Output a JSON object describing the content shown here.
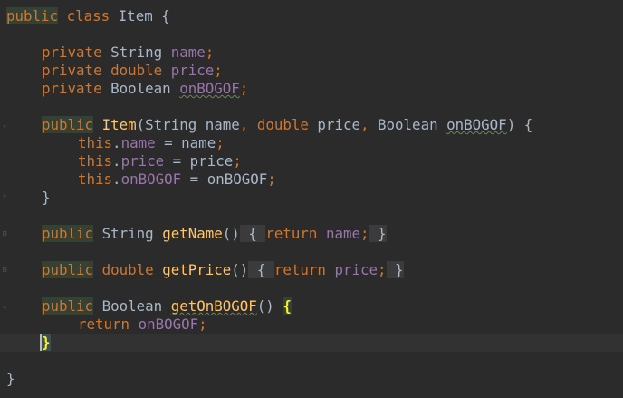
{
  "editor": {
    "class_decl": {
      "kw1": "public",
      "kw2": "class",
      "name": "Item",
      "brace": "{"
    },
    "fields": [
      {
        "mod": "private",
        "type": "String",
        "name": "name",
        "semi": ";"
      },
      {
        "mod": "private",
        "type": "double",
        "name": "price",
        "semi": ";"
      },
      {
        "mod": "private",
        "type": "Boolean",
        "name": "onBOGOF",
        "semi": ";"
      }
    ],
    "ctor": {
      "mod": "public",
      "name": "Item",
      "paren_open": "(",
      "type1": "String",
      "p1": "name",
      "comma1": ",",
      "type2": "double",
      "p2": "price",
      "comma2": ",",
      "type3": "Boolean",
      "p3": "onBOGOF",
      "paren_close": ")",
      "brace": "{",
      "body": [
        {
          "this": "this",
          "dot": ".",
          "field": "name",
          "eq": "=",
          "val": "name",
          "semi": ";"
        },
        {
          "this": "this",
          "dot": ".",
          "field": "price",
          "eq": "=",
          "val": "price",
          "semi": ";"
        },
        {
          "this": "this",
          "dot": ".",
          "field": "onBOGOF",
          "eq": "=",
          "val": "onBOGOF",
          "semi": ";"
        }
      ],
      "close": "}"
    },
    "getName": {
      "mod": "public",
      "type": "String",
      "name": "getName",
      "parens": "()",
      "open": "{",
      "ret": "return",
      "field": "name",
      "semi": ";",
      "close": "}"
    },
    "getPrice": {
      "mod": "public",
      "type": "double",
      "name": "getPrice",
      "parens": "()",
      "open": "{",
      "ret": "return",
      "field": "price",
      "semi": ";",
      "close": "}"
    },
    "getOnBOGOF": {
      "mod": "public",
      "type": "Boolean",
      "name": "getOnBOGOF",
      "parens": "()",
      "open": "{",
      "ret": "return",
      "field": "onBOGOF",
      "semi": ";",
      "close": "}"
    },
    "class_close": "}"
  }
}
